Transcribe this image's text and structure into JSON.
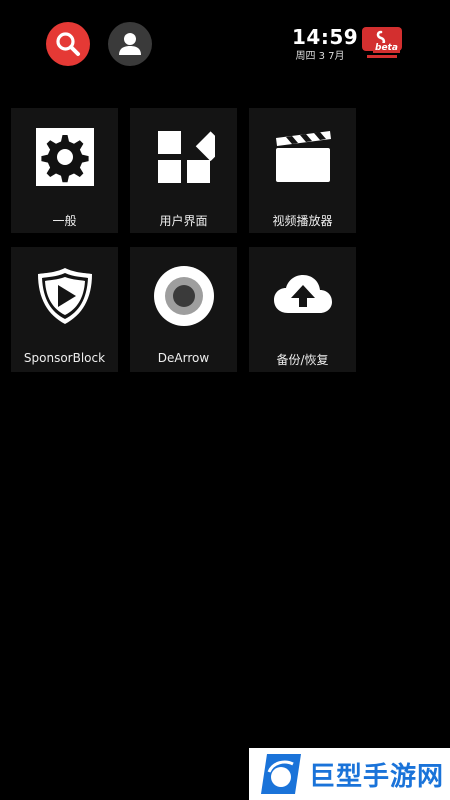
{
  "header": {
    "search_icon": "search-icon",
    "account_icon": "account-icon",
    "clock": {
      "time": "14:59",
      "date": "周四 3 7月"
    },
    "logo_label": "beta",
    "colors": {
      "search": "#e53935",
      "account": "#3a3a3a",
      "logo": "#d32f2f"
    }
  },
  "tiles": [
    {
      "label": "一般",
      "icon": "gear-icon"
    },
    {
      "label": "用户界面",
      "icon": "widgets-icon"
    },
    {
      "label": "视频播放器",
      "icon": "clapperboard-icon"
    },
    {
      "label": "SponsorBlock",
      "icon": "shield-play-icon"
    },
    {
      "label": "DeArrow",
      "icon": "dearrow-icon"
    },
    {
      "label": "备份/恢复",
      "icon": "cloud-upload-icon"
    }
  ],
  "watermark": {
    "text": "巨型手游网",
    "color": "#1a73d9"
  }
}
